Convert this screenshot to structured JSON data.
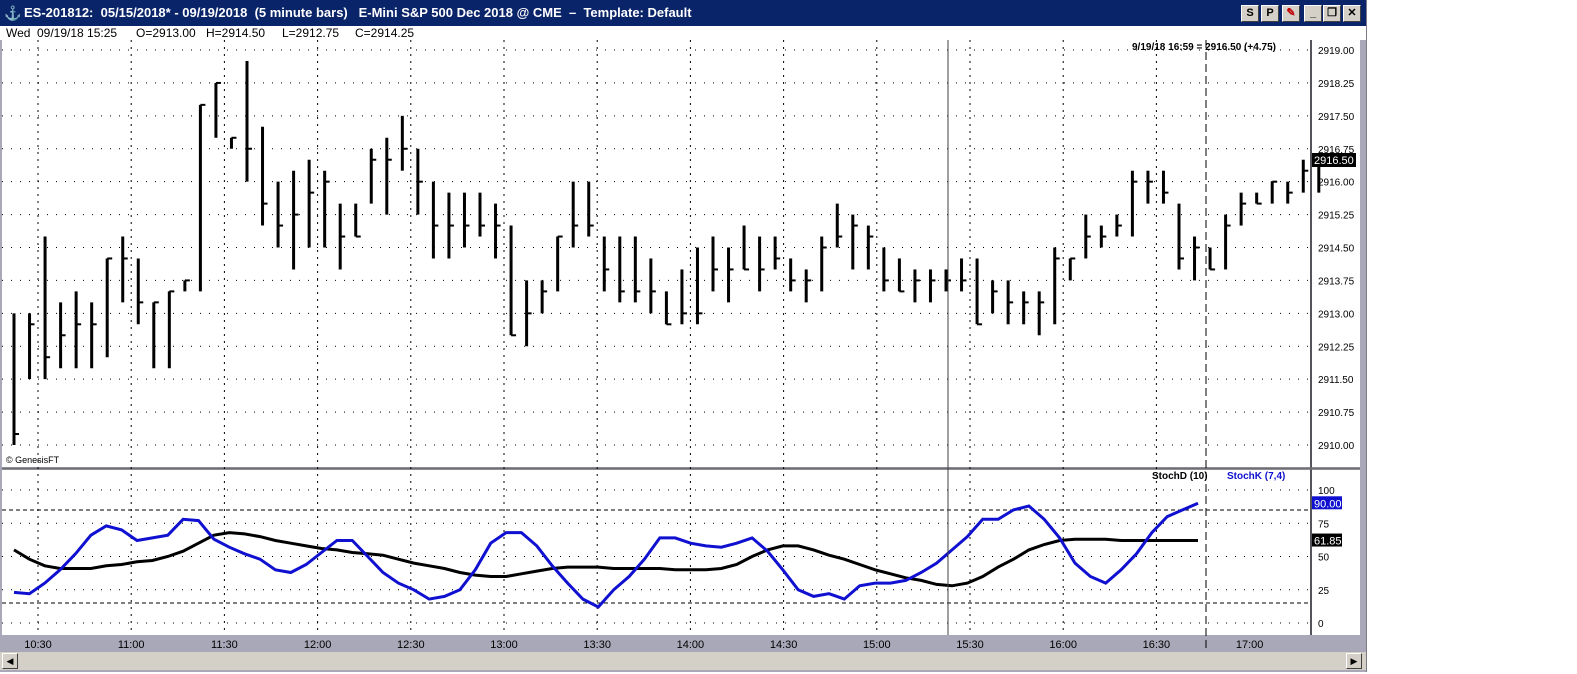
{
  "window": {
    "title": "ES-201812:  05/15/2018* - 09/19/2018  (5 minute bars)   E-Mini S&P 500 Dec 2018 @ CME  –  Template: Default",
    "icon": "app-anchor-icon",
    "buttons": [
      "S",
      "P"
    ]
  },
  "info": {
    "day": "Wed",
    "datetime": "09/19/18 15:25",
    "open": "O=2913.00",
    "high": "H=2914.50",
    "low": "L=2912.75",
    "close": "C=2914.25"
  },
  "price_panel": {
    "cursor_label": "9/19/18 16:59 = 2916.50 (+4.75)",
    "last_price": "2916.50",
    "copyright": "© GenesisFT",
    "y_ticks": [
      "2919.00",
      "2918.25",
      "2917.50",
      "2916.75",
      "2916.00",
      "2915.25",
      "2914.50",
      "2913.75",
      "2913.00",
      "2912.25",
      "2911.50",
      "2910.75",
      "2910.00"
    ]
  },
  "stoch_panel": {
    "legend_d": "StochD (10)",
    "legend_k": "StochK (7,4)",
    "value_k": "90.00",
    "value_d": "61.85",
    "y_ticks": [
      "100",
      "75",
      "50",
      "25",
      "0"
    ]
  },
  "x_ticks": [
    "10:30",
    "11:00",
    "11:30",
    "12:00",
    "12:30",
    "13:00",
    "13:30",
    "14:00",
    "14:30",
    "15:00",
    "15:30",
    "16:00",
    "16:30",
    "17:00"
  ],
  "colors": {
    "title_bg": "#0a246a",
    "stoch_k": "#1010d0",
    "stoch_d": "#000000",
    "frame": "#a8a8b8"
  },
  "chart_data": [
    {
      "type": "ohlc",
      "ylim": [
        2909.5,
        2919.5
      ],
      "x_step_minutes": 5,
      "first_bar_time": "10:20",
      "bars": [
        [
          2913.0,
          2910.0,
          2910.25
        ],
        [
          2913.0,
          2911.5,
          2912.75
        ],
        [
          2914.75,
          2911.5,
          2912.0
        ],
        [
          2913.25,
          2911.75,
          2912.5
        ],
        [
          2913.5,
          2911.75,
          2912.75
        ],
        [
          2913.25,
          2911.75,
          2912.75
        ],
        [
          2914.25,
          2912.0,
          2914.25
        ],
        [
          2914.75,
          2913.25,
          2914.25
        ],
        [
          2914.25,
          2912.75,
          2913.25
        ],
        [
          2913.25,
          2911.75,
          2913.25
        ],
        [
          2913.5,
          2911.75,
          2913.5
        ],
        [
          2913.75,
          2913.5,
          2913.75
        ],
        [
          2917.75,
          2913.5,
          2917.75
        ],
        [
          2918.25,
          2917.0,
          2918.25
        ],
        [
          2917.0,
          2916.75,
          2917.0
        ],
        [
          2918.75,
          2916.0,
          2916.75
        ],
        [
          2917.25,
          2915.0,
          2915.5
        ],
        [
          2916.0,
          2914.5,
          2915.0
        ],
        [
          2916.25,
          2914.0,
          2915.25
        ],
        [
          2916.5,
          2914.5,
          2915.75
        ],
        [
          2916.25,
          2914.5,
          2916.0
        ],
        [
          2915.5,
          2914.0,
          2914.75
        ],
        [
          2915.5,
          2914.75,
          2914.75
        ],
        [
          2916.75,
          2915.5,
          2916.5
        ],
        [
          2917.0,
          2915.25,
          2916.5
        ],
        [
          2917.5,
          2916.25,
          2916.75
        ],
        [
          2916.75,
          2915.25,
          2916.0
        ],
        [
          2916.0,
          2914.25,
          2915.0
        ],
        [
          2915.75,
          2914.25,
          2915.0
        ],
        [
          2915.75,
          2914.5,
          2915.0
        ],
        [
          2915.75,
          2914.75,
          2915.0
        ],
        [
          2915.5,
          2914.25,
          2915.0
        ],
        [
          2915.0,
          2912.5,
          2912.5
        ],
        [
          2913.75,
          2912.25,
          2913.0
        ],
        [
          2913.75,
          2913.0,
          2913.5
        ],
        [
          2914.75,
          2913.5,
          2914.75
        ],
        [
          2916.0,
          2914.5,
          2915.0
        ],
        [
          2916.0,
          2914.75,
          2915.0
        ],
        [
          2914.75,
          2913.5,
          2914.0
        ],
        [
          2914.75,
          2913.25,
          2913.5
        ],
        [
          2914.75,
          2913.25,
          2913.5
        ],
        [
          2914.25,
          2913.0,
          2913.5
        ],
        [
          2913.5,
          2912.75,
          2912.75
        ],
        [
          2914.0,
          2912.75,
          2913.0
        ],
        [
          2914.5,
          2912.75,
          2913.0
        ],
        [
          2914.75,
          2913.5,
          2914.0
        ],
        [
          2914.5,
          2913.25,
          2914.0
        ],
        [
          2915.0,
          2914.0,
          2914.0
        ],
        [
          2914.75,
          2913.5,
          2914.0
        ],
        [
          2914.75,
          2914.0,
          2914.25
        ],
        [
          2914.25,
          2913.5,
          2913.75
        ],
        [
          2914.0,
          2913.25,
          2913.75
        ],
        [
          2914.75,
          2913.5,
          2914.5
        ],
        [
          2915.5,
          2914.5,
          2914.75
        ],
        [
          2915.25,
          2914.0,
          2915.0
        ],
        [
          2915.0,
          2914.0,
          2914.75
        ],
        [
          2914.5,
          2913.5,
          2913.75
        ],
        [
          2914.25,
          2913.5,
          2913.5
        ],
        [
          2914.0,
          2913.25,
          2913.75
        ],
        [
          2914.0,
          2913.25,
          2913.75
        ],
        [
          2914.0,
          2913.5,
          2913.75
        ],
        [
          2914.25,
          2913.5,
          2913.75
        ],
        [
          2914.25,
          2912.75,
          2912.75
        ],
        [
          2913.75,
          2913.0,
          2913.5
        ],
        [
          2913.75,
          2912.75,
          2913.25
        ],
        [
          2913.5,
          2912.75,
          2913.25
        ],
        [
          2913.5,
          2912.5,
          2913.25
        ],
        [
          2914.5,
          2912.75,
          2914.25
        ],
        [
          2914.25,
          2913.75,
          2914.25
        ],
        [
          2915.25,
          2914.25,
          2914.75
        ],
        [
          2915.0,
          2914.5,
          2914.75
        ],
        [
          2915.25,
          2914.75,
          2915.0
        ],
        [
          2916.25,
          2914.75,
          2916.0
        ],
        [
          2916.25,
          2915.5,
          2916.0
        ],
        [
          2916.25,
          2915.5,
          2915.75
        ],
        [
          2915.5,
          2914.0,
          2914.25
        ],
        [
          2914.75,
          2913.75,
          2914.5
        ],
        [
          2914.5,
          2914.0,
          2914.0
        ],
        [
          2915.25,
          2914.0,
          2915.0
        ],
        [
          2915.75,
          2915.0,
          2915.5
        ],
        [
          2915.75,
          2915.5,
          2915.5
        ],
        [
          2916.0,
          2915.5,
          2916.0
        ],
        [
          2916.0,
          2915.5,
          2915.75
        ],
        [
          2916.5,
          2915.75,
          2916.25
        ],
        [
          2916.5,
          2915.75,
          2916.5
        ]
      ]
    },
    {
      "type": "line",
      "ylim": [
        0,
        100
      ],
      "series": [
        {
          "name": "StochK (7,4)",
          "values": [
            23,
            22,
            30,
            40,
            52,
            66,
            73,
            70,
            62,
            64,
            66,
            78,
            77,
            63,
            57,
            52,
            48,
            40,
            38,
            44,
            53,
            62,
            62,
            50,
            38,
            30,
            25,
            18,
            20,
            25,
            40,
            60,
            68,
            68,
            58,
            43,
            30,
            18,
            12,
            25,
            35,
            48,
            64,
            64,
            60,
            58,
            57,
            60,
            64,
            54,
            40,
            25,
            20,
            22,
            18,
            28,
            30,
            30,
            32,
            38,
            45,
            55,
            65,
            78,
            78,
            85,
            88,
            78,
            64,
            45,
            35,
            30,
            40,
            52,
            68,
            80,
            85,
            90
          ]
        },
        {
          "name": "StochD (10)",
          "values": [
            55,
            48,
            43,
            41,
            41,
            41,
            43,
            44,
            46,
            47,
            50,
            54,
            60,
            66,
            68,
            67,
            65,
            62,
            60,
            58,
            56,
            55,
            53,
            52,
            51,
            48,
            45,
            43,
            41,
            38,
            36,
            35,
            35,
            37,
            39,
            41,
            42,
            42,
            42,
            41,
            41,
            41,
            41,
            40,
            40,
            40,
            41,
            44,
            50,
            55,
            58,
            58,
            55,
            51,
            48,
            44,
            40,
            37,
            34,
            32,
            29,
            28,
            30,
            35,
            42,
            48,
            55,
            59,
            62,
            63,
            63,
            63,
            62,
            62,
            62,
            62,
            62,
            62
          ]
        }
      ]
    }
  ]
}
